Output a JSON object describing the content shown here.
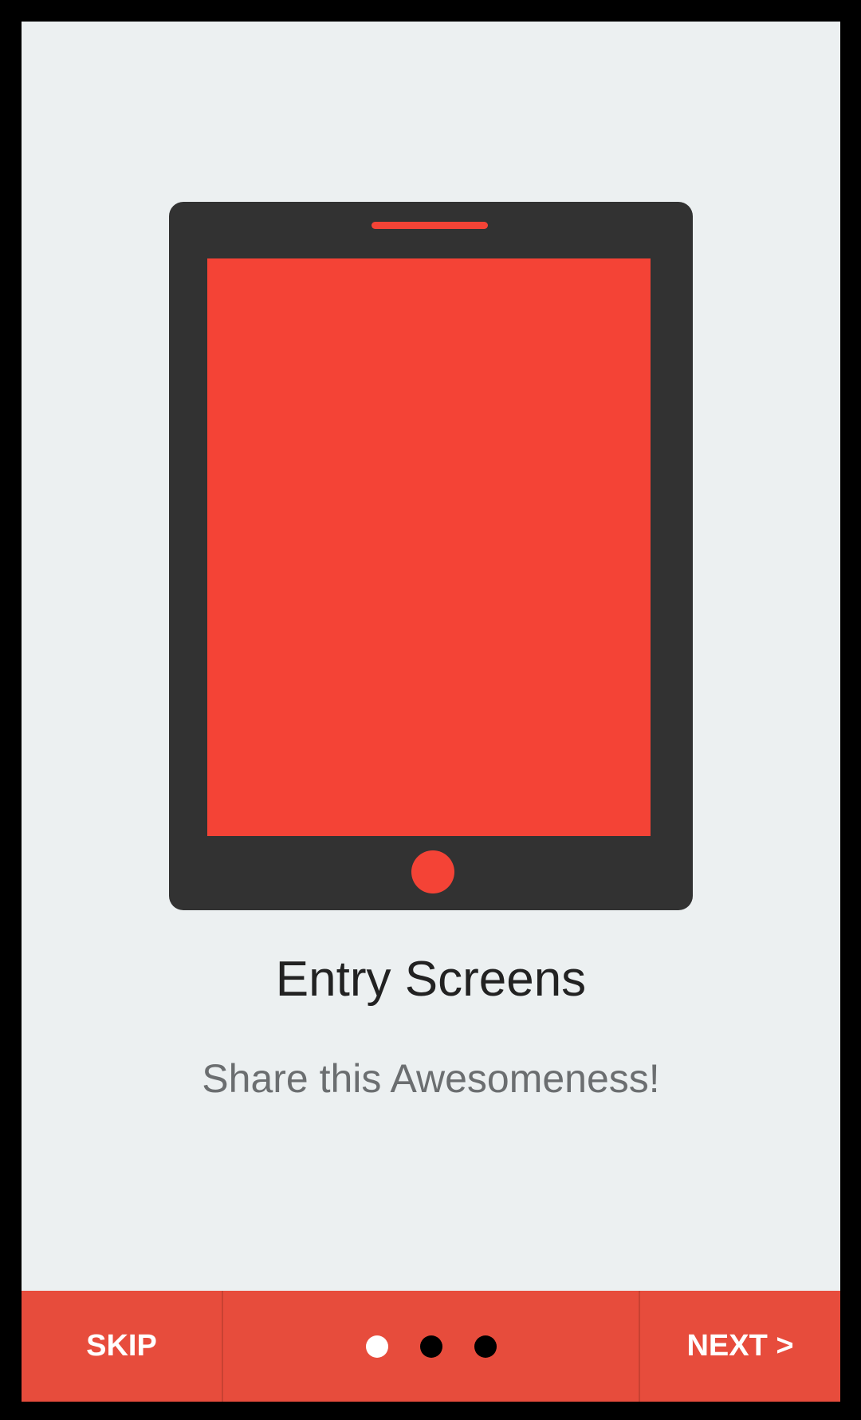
{
  "slide": {
    "title": "Entry Screens",
    "subtitle": "Share this Awesomeness!",
    "illustration_icon": "tablet-icon"
  },
  "bottom_bar": {
    "skip_label": "SKIP",
    "next_label": "NEXT >",
    "page_count": 3,
    "active_page": 1
  },
  "colors": {
    "background": "#ECF0F1",
    "accent": "#E74C3C",
    "tablet_body": "#323232",
    "tablet_screen": "#F44336",
    "title_text": "#222222",
    "subtitle_text": "#6B6E70"
  }
}
